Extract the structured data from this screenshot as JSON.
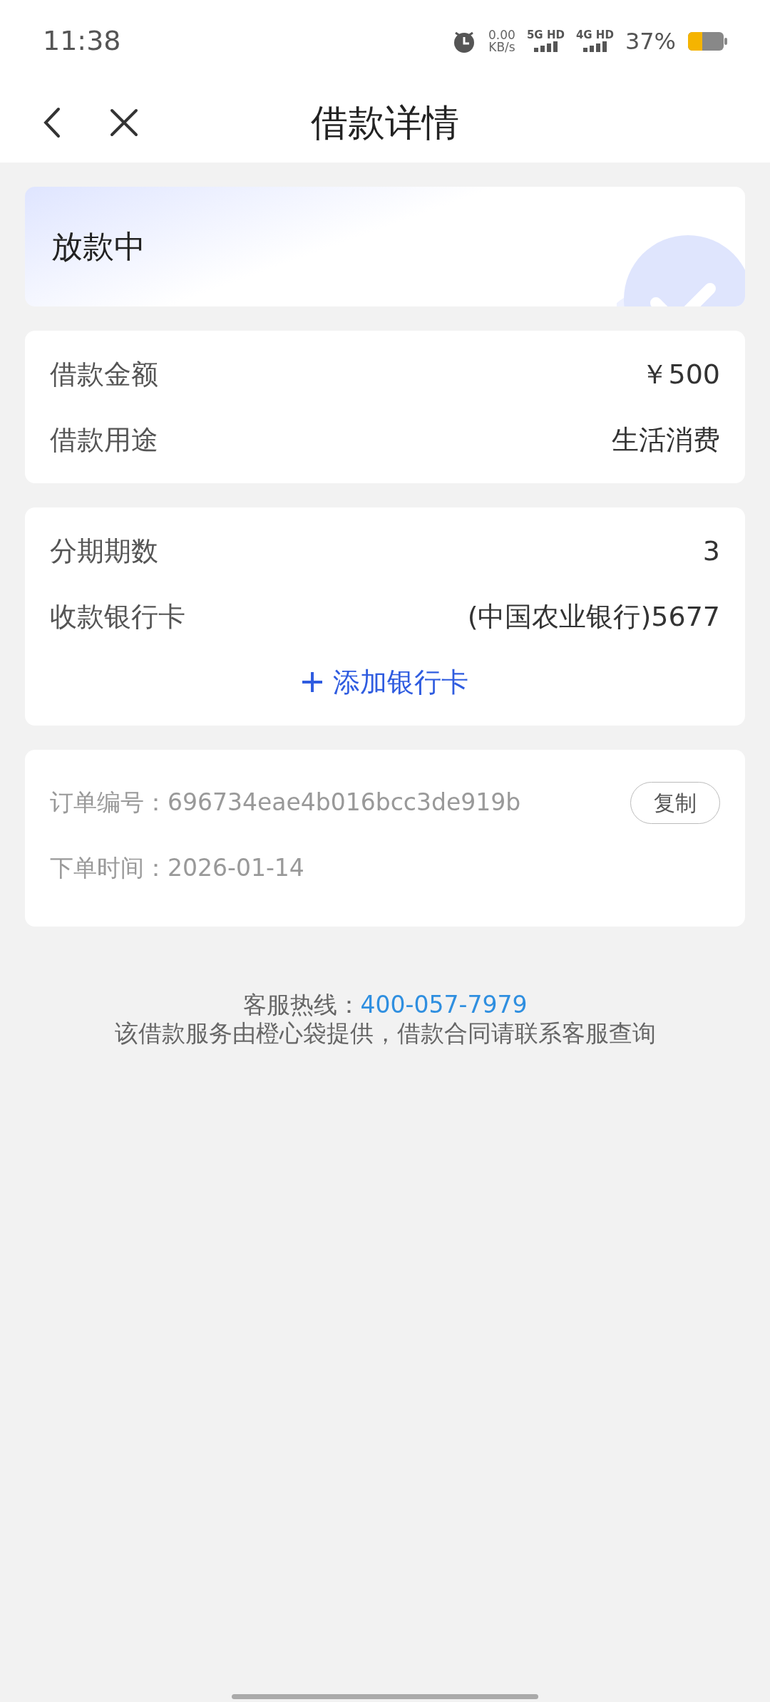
{
  "status_bar": {
    "time": "11:38",
    "net_speed": "0.00",
    "net_unit": "KB/s",
    "networks": [
      "5G HD",
      "4G HD"
    ],
    "battery": "37%"
  },
  "header": {
    "title": "借款详情"
  },
  "status_card": {
    "label": "放款中"
  },
  "loan_card": {
    "rows": [
      {
        "label": "借款金额",
        "value": "￥500"
      },
      {
        "label": "借款用途",
        "value": "生活消费"
      }
    ]
  },
  "plan_card": {
    "rows": [
      {
        "label": "分期期数",
        "value": "3"
      },
      {
        "label": "收款银行卡",
        "value": "(中国农业银行)5677"
      }
    ],
    "add_button": "添加银行卡"
  },
  "order_card": {
    "rows": [
      {
        "label": "订单编号：",
        "value": "696734eae4b016bcc3de919b"
      },
      {
        "label": "下单时间：",
        "value": "2026-01-14"
      }
    ],
    "copy_button": "复制"
  },
  "footer": {
    "hotline_label": "客服热线：",
    "hotline": "400-057-7979",
    "note": "该借款服务由橙心袋提供，借款合同请联系客服查询"
  }
}
